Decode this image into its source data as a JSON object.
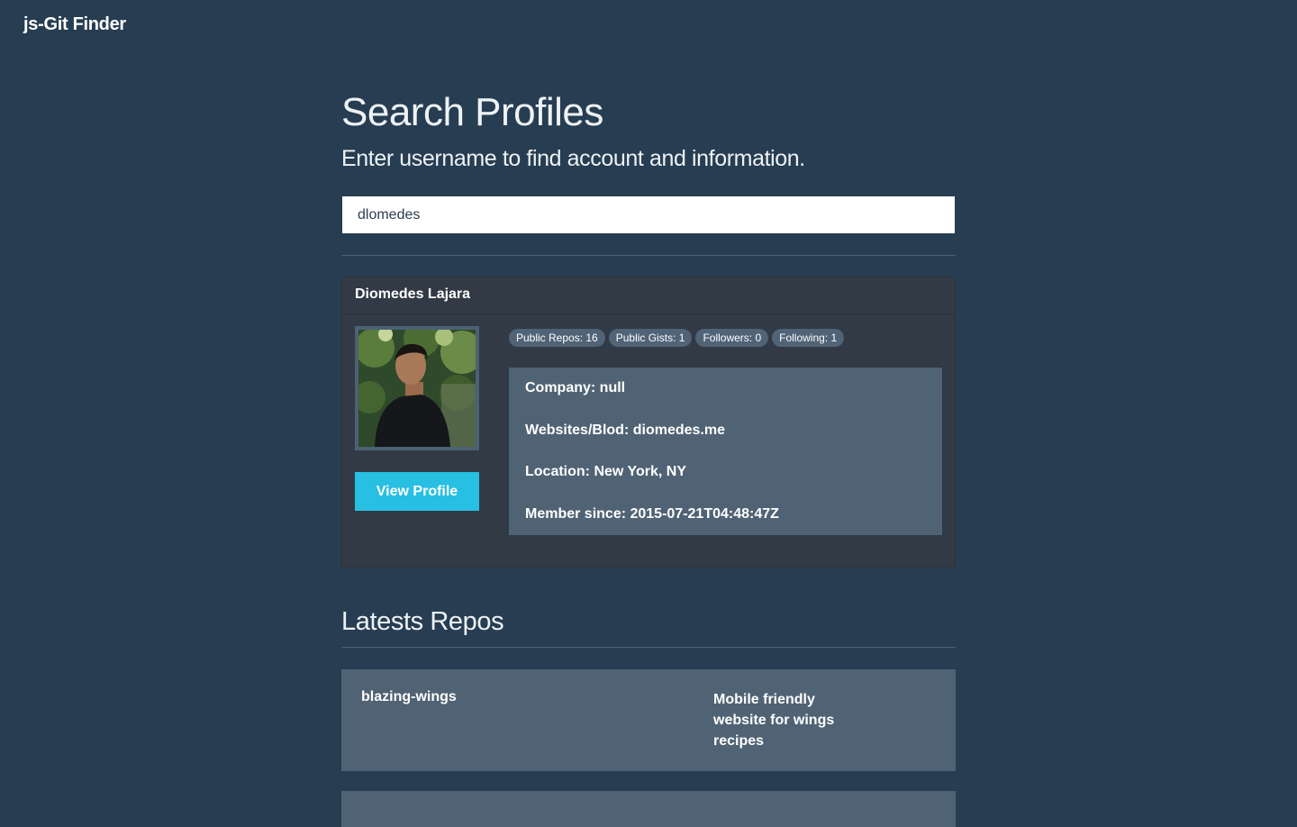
{
  "navbar": {
    "brand": "js-Git Finder"
  },
  "search": {
    "title": "Search Profiles",
    "subtitle": "Enter username to find account and information.",
    "value": "dlomedes"
  },
  "profile": {
    "name": "Diomedes Lajara",
    "view_profile_label": "View Profile",
    "badges": [
      "Public Repos: 16",
      "Public Gists: 1",
      "Followers: 0",
      "Following: 1"
    ],
    "info": [
      "Company: null",
      "Websites/Blod: diomedes.me",
      "Location: New York, NY",
      "Member since: 2015-07-21T04:48:47Z"
    ]
  },
  "repos": {
    "title": "Latests Repos",
    "items": [
      {
        "name": "blazing-wings",
        "description": "Mobile friendly website for wings recipes"
      }
    ]
  },
  "colors": {
    "background": "#273d52",
    "card": "#313a45",
    "panel": "#506374",
    "accent": "#27bfe2"
  }
}
